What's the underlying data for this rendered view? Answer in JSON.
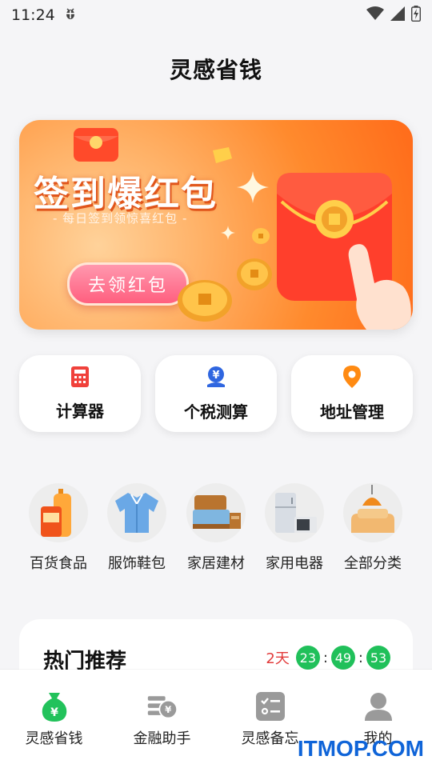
{
  "status_bar": {
    "time": "11:24",
    "icons": [
      "bug-icon",
      "wifi-icon",
      "signal-icon",
      "battery-icon"
    ]
  },
  "header": {
    "title": "灵感省钱"
  },
  "banner": {
    "title": "签到爆红包",
    "subtitle": "- 每日签到领惊喜红包 -",
    "button_label": "去领红包",
    "colors": {
      "accent": "#ff7a24",
      "button": "#ff6a88"
    }
  },
  "tools": [
    {
      "label": "计算器",
      "icon": "calculator-icon",
      "color": "#f0413b"
    },
    {
      "label": "个税测算",
      "icon": "tax-yen-icon",
      "color": "#2f66e0"
    },
    {
      "label": "地址管理",
      "icon": "location-pin-icon",
      "color": "#ff8a12"
    }
  ],
  "categories": [
    {
      "label": "百货食品",
      "icon": "grocery-bottles-icon"
    },
    {
      "label": "服饰鞋包",
      "icon": "shirt-icon"
    },
    {
      "label": "家居建材",
      "icon": "bed-icon"
    },
    {
      "label": "家用电器",
      "icon": "appliance-icon"
    },
    {
      "label": "全部分类",
      "icon": "sofa-lamp-icon"
    }
  ],
  "hot": {
    "title": "热门推荐",
    "countdown": {
      "days": "2天",
      "hours": "23",
      "minutes": "49",
      "seconds": "53",
      "sep": ":"
    }
  },
  "bottom_nav": [
    {
      "label": "灵感省钱",
      "icon": "money-bag-icon",
      "active": true
    },
    {
      "label": "金融助手",
      "icon": "finance-coin-icon",
      "active": false
    },
    {
      "label": "灵感备忘",
      "icon": "checklist-icon",
      "active": false
    },
    {
      "label": "我的",
      "icon": "user-icon",
      "active": false
    }
  ],
  "colors": {
    "active_green": "#22c25b",
    "inactive_gray": "#9a9a9a"
  },
  "watermark": "ITMOP.COM"
}
